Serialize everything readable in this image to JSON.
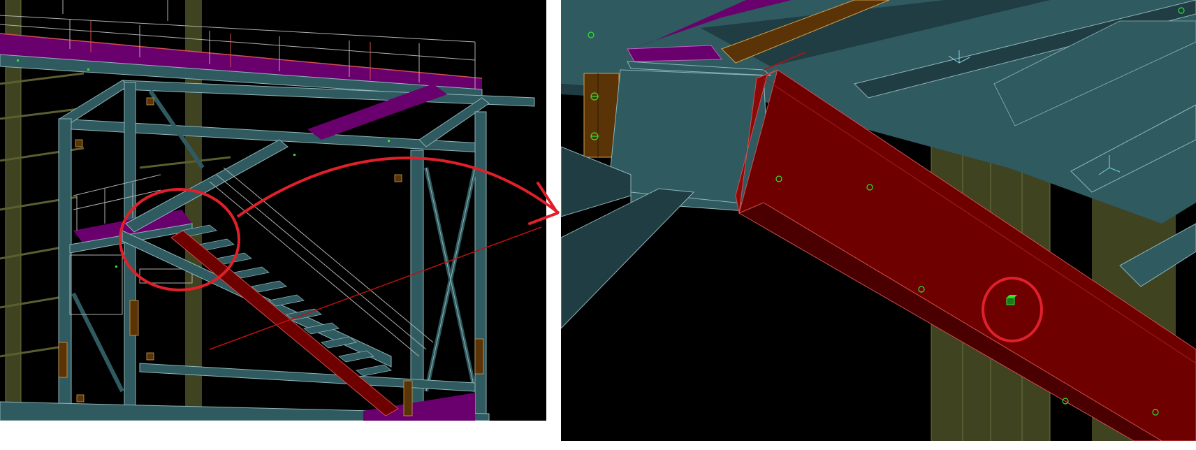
{
  "views": [
    {
      "name": "overview-3d-view",
      "description_hidden": true
    },
    {
      "name": "detail-3d-view",
      "description_hidden": true
    }
  ],
  "colors": {
    "background": "#000000",
    "member_teal": "#2f5a5f",
    "member_teal_dark": "#1f3d42",
    "member_edge": "#8fb5b8",
    "column_olive": "#3f4320",
    "column_olive_light": "#5a5e2e",
    "selected_red": "#6e0000",
    "selected_red_dark": "#4a0000",
    "grating_purple": "#6a006e",
    "plate_brown": "#5a3306",
    "railing_grey": "#b0b0b0",
    "railing_red": "#d05050",
    "bolt_green": "#2ee62e",
    "annotation_red": "#e0202a",
    "axis_cyan": "#7fd6e0"
  },
  "annotations": {
    "zoom_callout_circle": "circle",
    "zoom_arrow": "arrow-right",
    "target_marker_circle": "circle"
  }
}
